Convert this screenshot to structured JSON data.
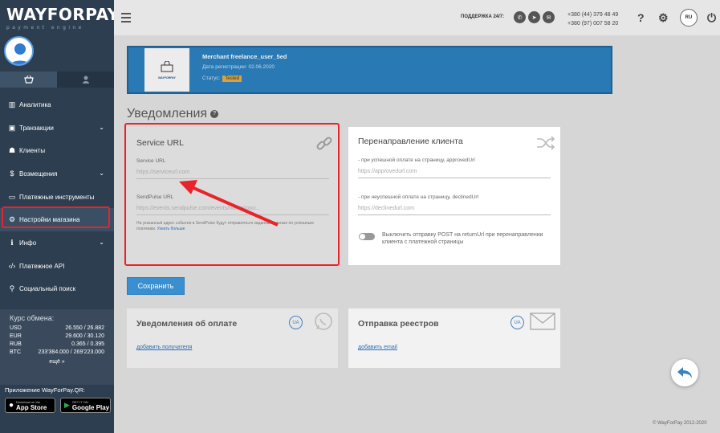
{
  "logo": {
    "brand": "WAYFORPAY",
    "tagline": "payment engine"
  },
  "sidebar": {
    "items": [
      {
        "label": "Аналитика",
        "icon": "bar-chart-icon"
      },
      {
        "label": "Транзакции",
        "icon": "wallet-icon"
      },
      {
        "label": "Клиенты",
        "icon": "users-icon"
      },
      {
        "label": "Возмещения",
        "icon": "dollar-icon"
      },
      {
        "label": "Платежные инструменты",
        "icon": "card-icon"
      },
      {
        "label": "Настройки магазина",
        "icon": "gear-icon"
      },
      {
        "label": "Инфо",
        "icon": "info-icon"
      },
      {
        "label": "Платежное API",
        "icon": "code-icon"
      },
      {
        "label": "Социальный поиск",
        "icon": "search-icon"
      }
    ],
    "rates": {
      "title": "Курс обмена:",
      "rows": [
        {
          "cur": "USD",
          "val": "26.550 / 26.882"
        },
        {
          "cur": "EUR",
          "val": "29.600 / 30.120"
        },
        {
          "cur": "RUB",
          "val": "0.365 / 0.395"
        },
        {
          "cur": "BTC",
          "val": "233'384.000 / 269'223.000"
        }
      ],
      "more": "ещё"
    },
    "apps": {
      "title": "Приложение WayForPay.QR:",
      "appstore_small": "Download on the",
      "appstore_big": "App Store",
      "google_small": "GET IT ON",
      "google_big": "Google Play"
    }
  },
  "topbar": {
    "support": "ПОДДЕРЖКА 24/7:",
    "phone1": "+380 (44) 379 48 49",
    "phone2": "+380 (97) 007 58 20",
    "lang": "RU"
  },
  "merchant": {
    "logo_text": "WAYFORPAY",
    "name": "Merchant freelance_user_5ed",
    "date": "Дата регистрации: 02.06.2020",
    "status_label": "Статус:",
    "status": "Tested"
  },
  "page": {
    "title": "Уведомления"
  },
  "service": {
    "title": "Service URL",
    "url_label": "Service URL",
    "url_placeholder": "https://serviceurl.com",
    "sendpulse_label": "SendPulse URL",
    "sendpulse_placeholder": "https://events.sendpulse.com/events/name/xxxx...",
    "note": "На указанный адрес события в SendPulse будут отправляться заданные данные по успешным платежам.",
    "note_link": "Узнать больше"
  },
  "redirect": {
    "title": "Перенаправление клиента",
    "approved_label": "- при успешной оплате на страницу, approvedUrl",
    "approved_placeholder": "https://approvedurl.com",
    "declined_label": "- при неуспешной оплате на страницу, declinedUrl",
    "declined_placeholder": "https://declinedurl.com",
    "toggle_text": "Выключить отправку POST на returnUrl при перенаправлении клиента с платежной страницы"
  },
  "save_label": "Сохранить",
  "payment_notify": {
    "title": "Уведомления об оплате",
    "ua": "UA",
    "link": "добавить получателя"
  },
  "registry": {
    "title": "Отправка реестров",
    "ua": "UA",
    "link": "добавить email"
  },
  "footer": {
    "copyright": "© WayForPay 2012-2020"
  },
  "colors": {
    "sidebar": "#2d3e50",
    "accent": "#2979b4",
    "highlight": "#e8232a"
  }
}
